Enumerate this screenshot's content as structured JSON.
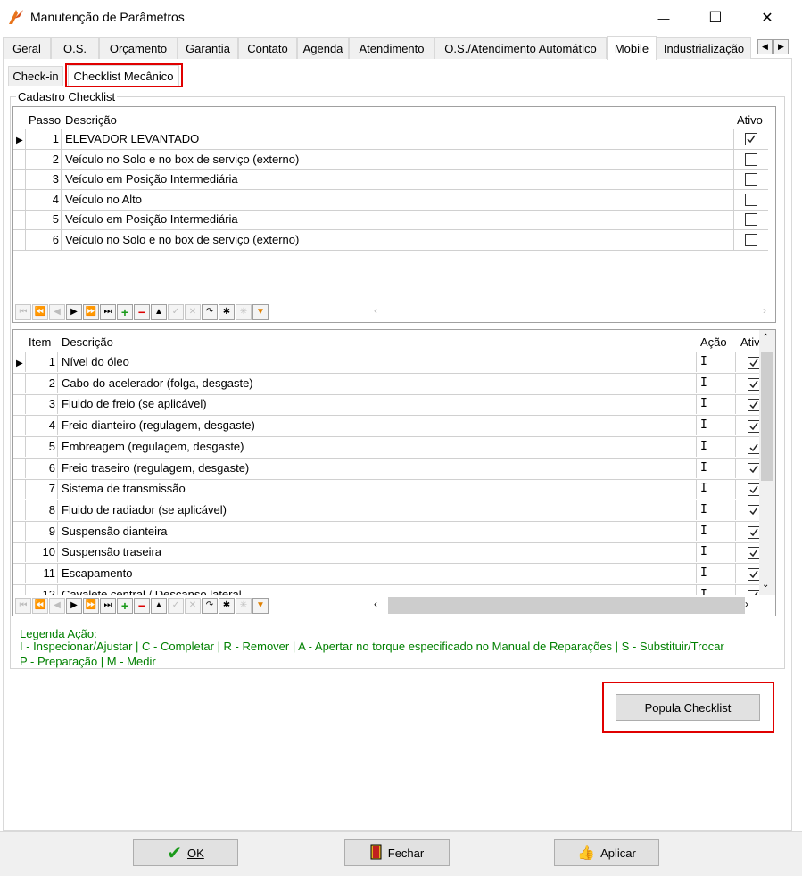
{
  "window": {
    "title": "Manutenção de Parâmetros",
    "minimize_glyph": "—",
    "maximize_glyph": "☐",
    "close_glyph": "✕"
  },
  "main_tabs": [
    {
      "label": "Geral"
    },
    {
      "label": "O.S."
    },
    {
      "label": "Orçamento"
    },
    {
      "label": "Garantia"
    },
    {
      "label": "Contato"
    },
    {
      "label": "Agenda"
    },
    {
      "label": "Atendimento"
    },
    {
      "label": "O.S./Atendimento Automático"
    },
    {
      "label": "Mobile"
    },
    {
      "label": "Industrialização"
    }
  ],
  "active_main_tab": "Mobile",
  "sub_tabs": [
    {
      "label": "Check-in"
    },
    {
      "label": "Checklist Mecânico"
    }
  ],
  "group": {
    "title": "Cadastro Checklist"
  },
  "steps_grid": {
    "headers": {
      "passo": "Passo",
      "descricao": "Descrição",
      "ativo": "Ativo"
    },
    "rows": [
      {
        "passo": "1",
        "descricao": "ELEVADOR LEVANTADO",
        "ativo": true
      },
      {
        "passo": "2",
        "descricao": "Veículo no Solo e no box de serviço (externo)",
        "ativo": false
      },
      {
        "passo": "3",
        "descricao": "Veículo em Posição Intermediária",
        "ativo": false
      },
      {
        "passo": "4",
        "descricao": "Veículo no Alto",
        "ativo": false
      },
      {
        "passo": "5",
        "descricao": "Veículo em Posição Intermediária",
        "ativo": false
      },
      {
        "passo": "6",
        "descricao": "Veículo no Solo e no box de serviço (externo)",
        "ativo": false
      }
    ]
  },
  "items_grid": {
    "headers": {
      "item": "Item",
      "descricao": "Descrição",
      "acao": "Ação",
      "ativo": "Ativ"
    },
    "rows": [
      {
        "item": "1",
        "descricao": "Nível do óleo",
        "acao": "I",
        "ativo": true
      },
      {
        "item": "2",
        "descricao": "Cabo do acelerador (folga, desgaste)",
        "acao": "I",
        "ativo": true
      },
      {
        "item": "3",
        "descricao": "Fluido de freio (se aplicável)",
        "acao": "I",
        "ativo": true
      },
      {
        "item": "4",
        "descricao": "Freio dianteiro (regulagem, desgaste)",
        "acao": "I",
        "ativo": true
      },
      {
        "item": "5",
        "descricao": "Embreagem (regulagem, desgaste)",
        "acao": "I",
        "ativo": true
      },
      {
        "item": "6",
        "descricao": "Freio traseiro (regulagem, desgaste)",
        "acao": "I",
        "ativo": true
      },
      {
        "item": "7",
        "descricao": "Sistema de transmissão",
        "acao": "I",
        "ativo": true
      },
      {
        "item": "8",
        "descricao": "Fluido de radiador (se aplicável)",
        "acao": "I",
        "ativo": true
      },
      {
        "item": "9",
        "descricao": "Suspensão dianteira",
        "acao": "I",
        "ativo": true
      },
      {
        "item": "10",
        "descricao": "Suspensão traseira",
        "acao": "I",
        "ativo": true
      },
      {
        "item": "11",
        "descricao": "Escapamento",
        "acao": "I",
        "ativo": true
      },
      {
        "item": "12",
        "descricao": "Cavalete central / Descanso lateral",
        "acao": "I",
        "ativo": true
      }
    ]
  },
  "legend": {
    "title": "Legenda Ação:",
    "line1": "I - Inspecionar/Ajustar | C - Completar | R - Remover | A - Apertar no torque especificado no Manual de Reparações | S - Substituir/Trocar",
    "line2": "P - Preparação | M - Medir"
  },
  "actions": {
    "popula_label": "Popula Checklist",
    "ok_label": "OK",
    "fechar_label": "Fechar",
    "aplicar_label": "Aplicar"
  },
  "colors": {
    "highlight": "#e00000",
    "legend_text": "#008000"
  }
}
